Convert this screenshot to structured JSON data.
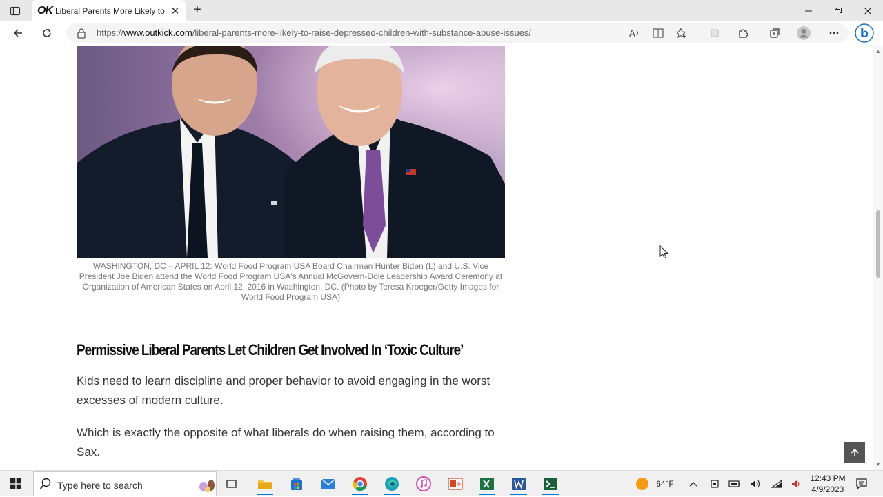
{
  "browser": {
    "tab_title": "Liberal Parents More Likely to Raise Depressed Children",
    "favicon_text": "OK",
    "url_scheme": "https://",
    "url_host": "www.outkick.com",
    "url_path": "/liberal-parents-more-likely-to-raise-depressed-children-with-substance-abuse-issues/",
    "profile_badge": "b"
  },
  "article": {
    "photo_caption": "WASHINGTON, DC – APRIL 12: World Food Program USA Board Chairman Hunter Biden (L) and U.S. Vice President Joe Biden attend the World Food Program USA's Annual McGovern-Dole Leadership Award Ceremony at Organization of American States on April 12, 2016 in Washington, DC. (Photo by Teresa Kroeger/Getty Images for World Food Program USA)",
    "subhead": "Permissive Liberal Parents Let Children Get Involved In ‘Toxic Culture’",
    "paragraphs": [
      "Kids need to learn discipline and proper behavior to avoid engaging in the worst excesses of modern culture.",
      "Which is exactly the opposite of what liberals do when raising them, according to Sax."
    ],
    "back_to_top_icon": "arrow-up-icon"
  },
  "taskbar": {
    "search_placeholder": "Type here to search",
    "weather_temp": "64°F",
    "time": "12:43 PM",
    "date": "4/9/2023",
    "colors": {
      "accent": "#0078d4",
      "weather_sun": "#f39c12"
    }
  }
}
